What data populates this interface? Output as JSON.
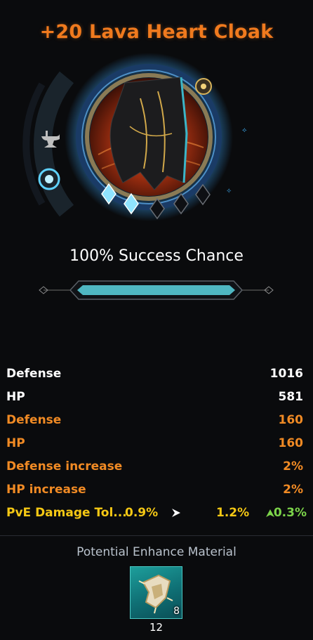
{
  "item": {
    "title": "+20 Lava Heart Cloak",
    "success_chance_text": "100% Success Chance",
    "success_chance_fill": 1.0,
    "enhance_stars_filled": 2,
    "enhance_stars_total": 5
  },
  "stats": [
    {
      "label": "Defense",
      "value": "1016",
      "color": "#ffffff"
    },
    {
      "label": "HP",
      "value": "581",
      "color": "#ffffff"
    },
    {
      "label": "Defense",
      "value": "160",
      "color": "#f08a24"
    },
    {
      "label": "HP",
      "value": "160",
      "color": "#f08a24"
    },
    {
      "label": "Defense increase",
      "value": "2%",
      "color": "#f08a24"
    },
    {
      "label": "HP increase",
      "value": "2%",
      "color": "#f08a24"
    }
  ],
  "pve": {
    "label": "PvE Damage Tol...",
    "current": "0.9%",
    "next": "1.2%",
    "delta": "0.3%",
    "color": "#f5c814",
    "delta_color": "#7cd44a"
  },
  "potential": {
    "title": "Potential Enhance Material",
    "material_icon": "cloak-fragment-icon",
    "material_count_badge": "8",
    "material_required": "12"
  },
  "colors": {
    "accent_orange": "#f07a1e",
    "bar_teal": "#4fb7c2",
    "background": "#0a0b0d"
  }
}
